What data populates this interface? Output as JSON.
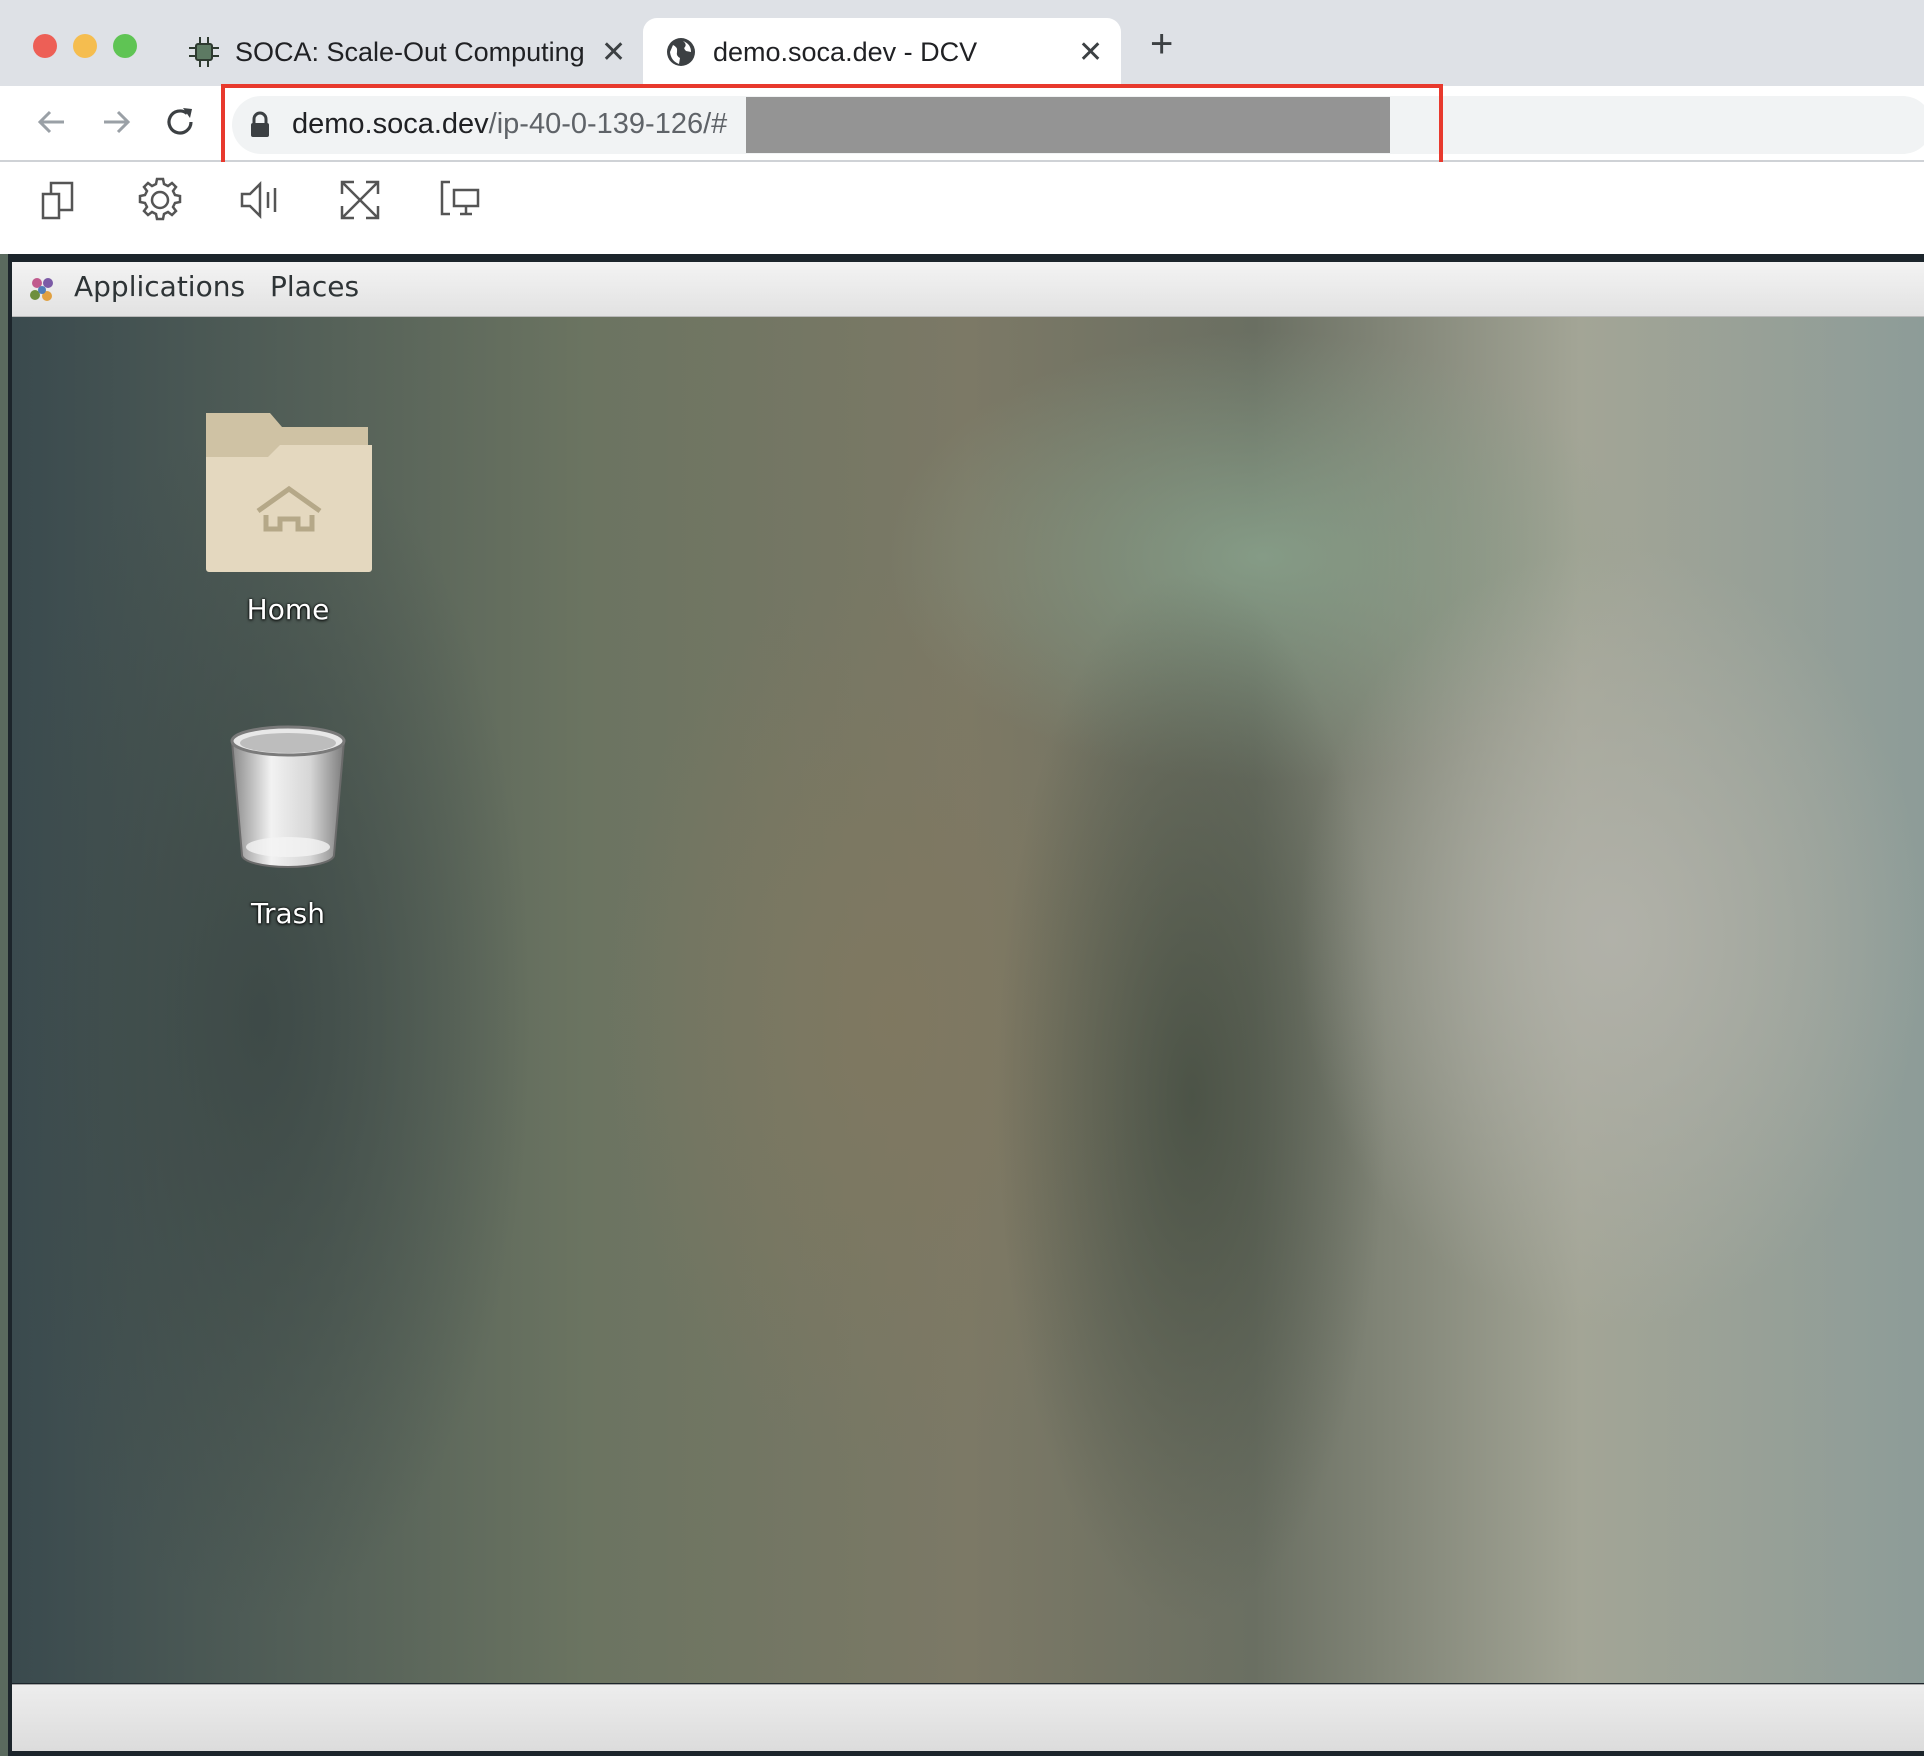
{
  "window": {
    "traffic_lights": {
      "close_color": "#ed5f56",
      "minimize_color": "#f5bd4f",
      "zoom_color": "#5fc454"
    }
  },
  "tabs": [
    {
      "title": "SOCA: Scale-Out Computing o",
      "favicon": "bug-circuit-icon",
      "close": "✕",
      "active": false
    },
    {
      "title": "demo.soca.dev - DCV",
      "favicon": "globe-icon",
      "close": "✕",
      "active": true
    }
  ],
  "new_tab_label": "+",
  "toolbar": {
    "back": "arrow-left-icon",
    "forward": "arrow-right-icon",
    "reload": "reload-icon"
  },
  "address_bar": {
    "lock_icon": "lock-icon",
    "host": "demo.soca.dev",
    "path": "/ip-40-0-139-126/#",
    "redacted": true,
    "highlight_color": "#e8392d"
  },
  "dcv_toolbar": [
    {
      "name": "clipboard-icon"
    },
    {
      "name": "settings-gear-icon"
    },
    {
      "name": "audio-speaker-icon"
    },
    {
      "name": "fullscreen-expand-icon"
    },
    {
      "name": "multi-monitor-icon"
    }
  ],
  "gnome_panel": {
    "applications_label": "Applications",
    "places_label": "Places",
    "applications_icon": "gnome-foot-icon"
  },
  "desktop_icons": [
    {
      "label": "Home",
      "icon": "home-folder-icon"
    },
    {
      "label": "Trash",
      "icon": "trash-can-icon"
    }
  ]
}
